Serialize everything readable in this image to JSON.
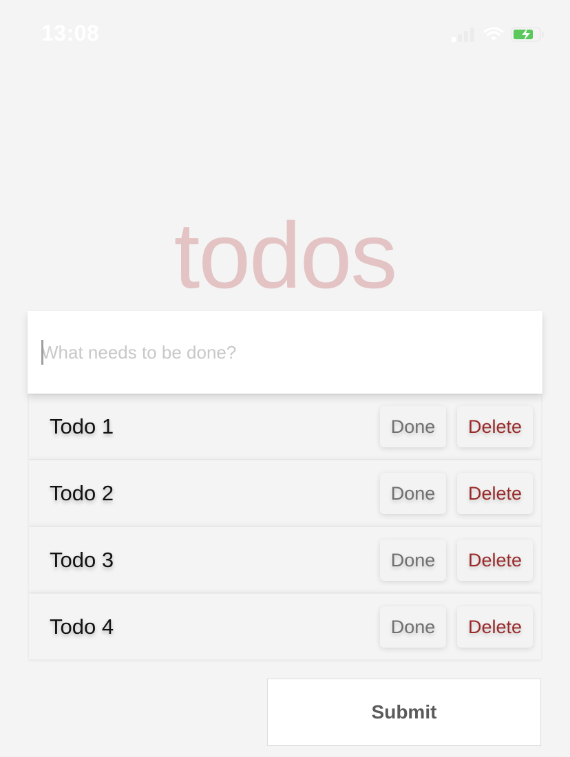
{
  "status_bar": {
    "time": "13:08",
    "icons": [
      "cellular-signal-icon",
      "wifi-icon",
      "battery-charging-icon"
    ],
    "battery_color": "#5ac85a"
  },
  "app": {
    "title": "todos",
    "title_color": "#e0c3c3"
  },
  "new_todo": {
    "placeholder": "What needs to be done?",
    "value": ""
  },
  "todos": [
    {
      "label": "Todo 1",
      "done_label": "Done",
      "delete_label": "Delete"
    },
    {
      "label": "Todo 2",
      "done_label": "Done",
      "delete_label": "Delete"
    },
    {
      "label": "Todo 3",
      "done_label": "Done",
      "delete_label": "Delete"
    },
    {
      "label": "Todo 4",
      "done_label": "Done",
      "delete_label": "Delete"
    }
  ],
  "colors": {
    "background": "#f4f4f4",
    "delete_text": "#9a2a2a",
    "done_text": "#6f6f6f",
    "submit_text": "#5a5a5a"
  },
  "submit": {
    "label": "Submit"
  }
}
